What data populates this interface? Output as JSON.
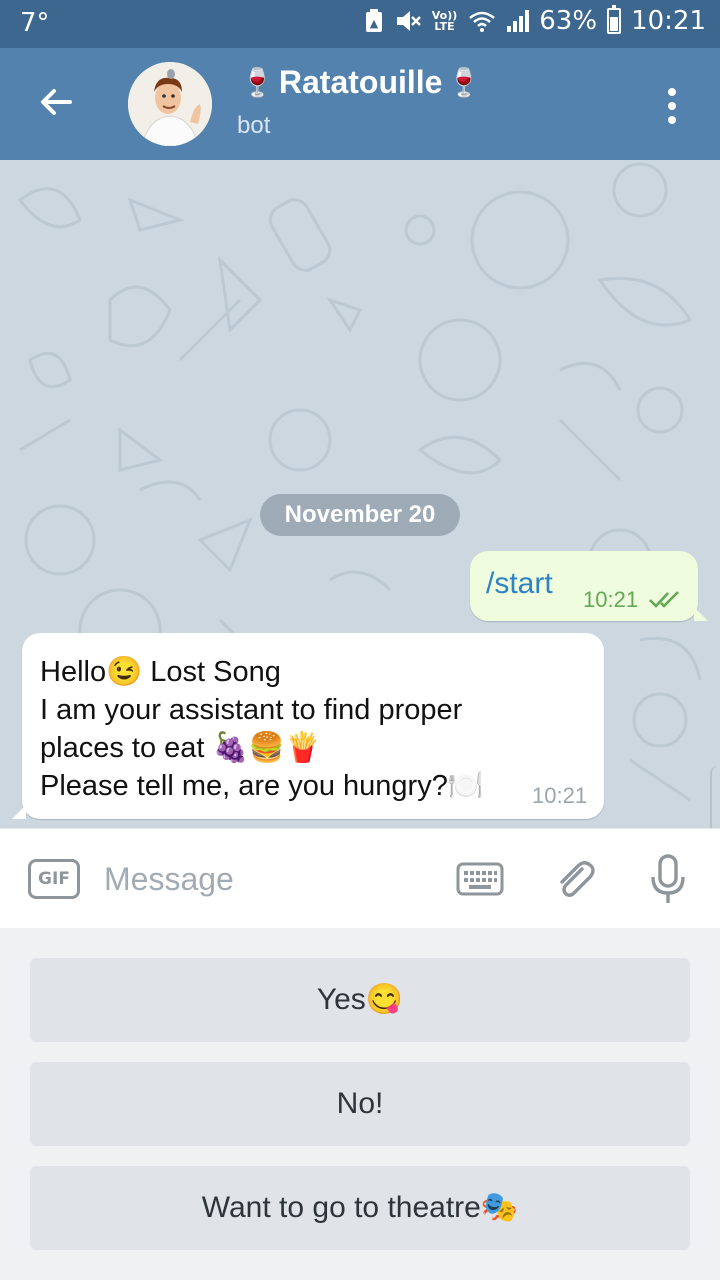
{
  "status_bar": {
    "temperature": "7°",
    "volte": "Vo))",
    "lte": "LTE",
    "battery_percent": "63%",
    "time": "10:21",
    "battery_level": 0.63
  },
  "header": {
    "title": "Ratatouille",
    "title_prefix_emoji": "🍷",
    "title_suffix_emoji": "🍷",
    "subtitle": "bot"
  },
  "chat": {
    "date_label": "November 20",
    "outgoing": {
      "text": "/start",
      "time": "10:21",
      "status": "read"
    },
    "incoming": {
      "lines": [
        "Hello😉 Lost Song",
        "I am your assistant to find proper",
        "places to eat 🍇🍔🍟",
        "Please tell me, are you hungry?🍽️"
      ],
      "time": "10:21"
    }
  },
  "input": {
    "gif_label": "GIF",
    "placeholder": "Message"
  },
  "reply_keyboard": {
    "buttons": [
      "Yes😋",
      "No!",
      "Want to go to theatre🎭"
    ]
  },
  "colors": {
    "status_bar": "#3d678e",
    "header": "#5282ad",
    "chat_bg": "#ccd7df",
    "outgoing_bubble": "#effdde",
    "outgoing_text": "#2f82c4",
    "read_ticks": "#62a856",
    "keyboard_bg": "#f0f1f3",
    "keyboard_button": "#e0e4e8"
  },
  "icons": {
    "back": "arrow-left",
    "menu": "more-vertical",
    "keyboard": "keyboard",
    "attach": "paperclip",
    "voice": "microphone"
  }
}
